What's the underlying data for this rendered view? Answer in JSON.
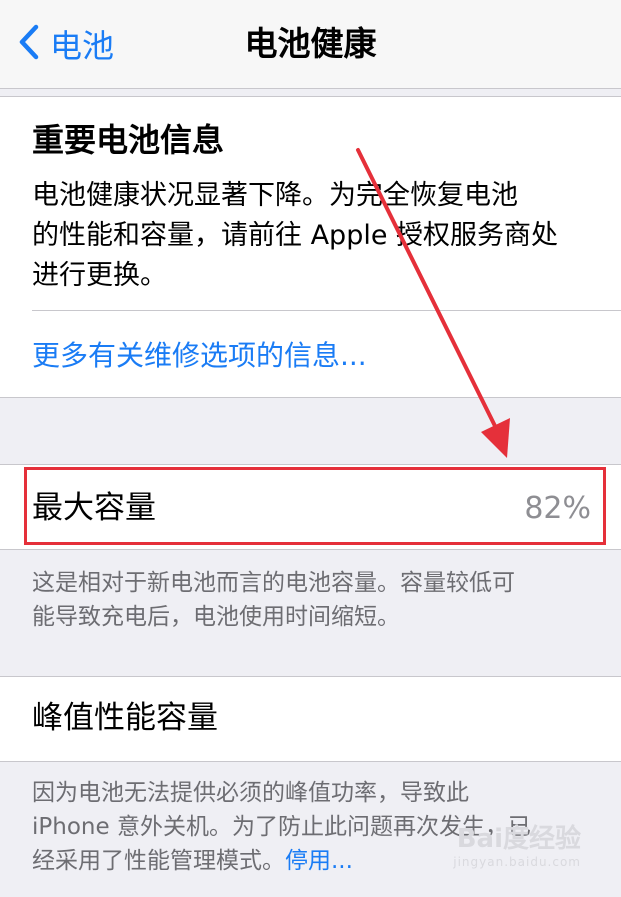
{
  "navbar": {
    "back_label": "电池",
    "title": "电池健康"
  },
  "battery_info": {
    "title": "重要电池信息",
    "body_lines": [
      "电池健康状况显著下降。为完全恢复电池",
      "的性能和容量，请前往 Apple 授权服务商处",
      "进行更换。"
    ],
    "link": "更多有关维修选项的信息..."
  },
  "max_capacity": {
    "label": "最大容量",
    "value": "82%",
    "footnote_lines": [
      "这是相对于新电池而言的电池容量。容量较低可",
      "能导致充电后，电池使用时间缩短。"
    ]
  },
  "peak_performance": {
    "label": "峰值性能容量",
    "footnote_lines": [
      "因为电池无法提供必须的峰值功率，导致此",
      "iPhone 意外关机。为了防止此问题再次发生，已",
      "经采用了性能管理模式。"
    ],
    "disable_link": "停用..."
  },
  "annotation": {
    "color": "#e5303a"
  },
  "watermark": {
    "main": "Bai度经验",
    "sub": "jingyan.baidu.com"
  },
  "colors": {
    "accent": "#1a7cf5",
    "background": "#efeff4",
    "secondary_text": "#8e8e93"
  }
}
